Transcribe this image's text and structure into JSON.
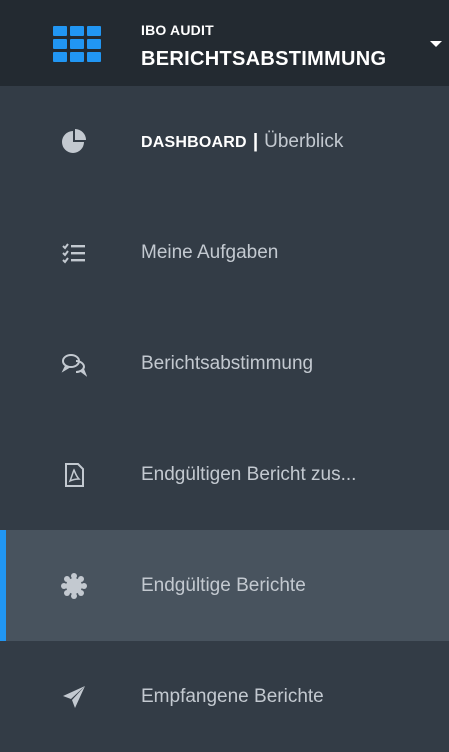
{
  "header": {
    "subtitle": "IBO AUDIT",
    "title": "BERICHTSABSTIMMUNG"
  },
  "nav": {
    "dashboard": {
      "label_strong": "DASHBOARD",
      "separator": "|",
      "label_sub": "Überblick",
      "icon": "pie-chart-icon"
    },
    "tasks": {
      "label": "Meine Aufgaben",
      "icon": "task-list-icon"
    },
    "reconciliation": {
      "label": "Berichtsabstimmung",
      "icon": "chat-bubbles-icon"
    },
    "finalize": {
      "label": "Endgültigen Bericht zus...",
      "icon": "pdf-file-icon"
    },
    "final_reports": {
      "label": "Endgültige Berichte",
      "icon": "certificate-icon",
      "active": true
    },
    "received": {
      "label": "Empfangene Berichte",
      "icon": "paper-plane-icon"
    }
  },
  "colors": {
    "accent": "#2196f3",
    "header_bg": "#232a31",
    "sidebar_bg": "#333c46",
    "active_bg": "#48535e",
    "text": "#c3c9d0"
  }
}
